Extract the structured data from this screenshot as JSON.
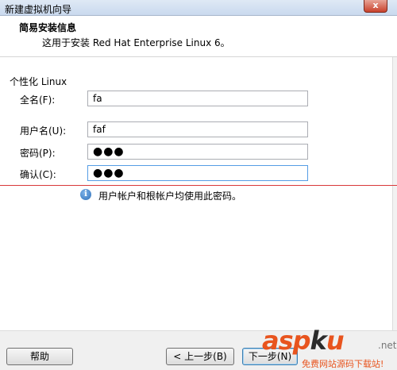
{
  "window": {
    "title": "新建虚拟机向导",
    "close_glyph": "x"
  },
  "header": {
    "title": "简易安装信息",
    "subtitle": "这用于安装 Red Hat Enterprise Linux 6。"
  },
  "form": {
    "group_label": "个性化 Linux",
    "fullname": {
      "label": "全名(F):",
      "value": "fa"
    },
    "username": {
      "label": "用户名(U):",
      "value": "faf"
    },
    "password": {
      "label": "密码(P):",
      "value": "●●●"
    },
    "confirm": {
      "label": "确认(C):",
      "value": "●●●"
    }
  },
  "info": {
    "icon": "info-icon",
    "text": "用户帐户和根帐户均使用此密码。"
  },
  "footer": {
    "help_label": "帮助",
    "back_label": "< 上一步(B)",
    "next_label": "下一步(N)"
  },
  "watermark": {
    "logo_a": "asp",
    "logo_b": "k",
    "logo_c": "u",
    "domain_suffix": ".net",
    "tagline": "免费网站源码下载站!"
  },
  "colors": {
    "accent_red_line": "#d9383a",
    "focus_border": "#569de5",
    "watermark_orange": "#e8541e"
  }
}
